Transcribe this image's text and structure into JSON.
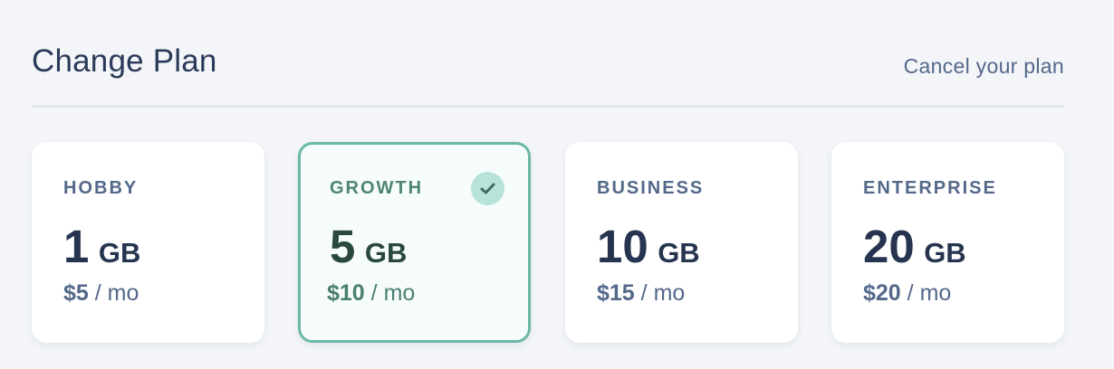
{
  "header": {
    "title": "Change Plan",
    "cancel_label": "Cancel your plan"
  },
  "plans": [
    {
      "name": "HOBBY",
      "storage_value": "1",
      "storage_unit": "GB",
      "price": "$5",
      "period": "/ mo",
      "selected": false
    },
    {
      "name": "GROWTH",
      "storage_value": "5",
      "storage_unit": "GB",
      "price": "$10",
      "period": "/ mo",
      "selected": true
    },
    {
      "name": "BUSINESS",
      "storage_value": "10",
      "storage_unit": "GB",
      "price": "$15",
      "period": "/ mo",
      "selected": false
    },
    {
      "name": "ENTERPRISE",
      "storage_value": "20",
      "storage_unit": "GB",
      "price": "$20",
      "period": "/ mo",
      "selected": false
    }
  ],
  "icons": {
    "selected_check": "check-icon"
  },
  "colors": {
    "accent": "#6bb8a8",
    "badge": "#b7e3d8",
    "text": "#26344f",
    "muted": "#54688a"
  }
}
